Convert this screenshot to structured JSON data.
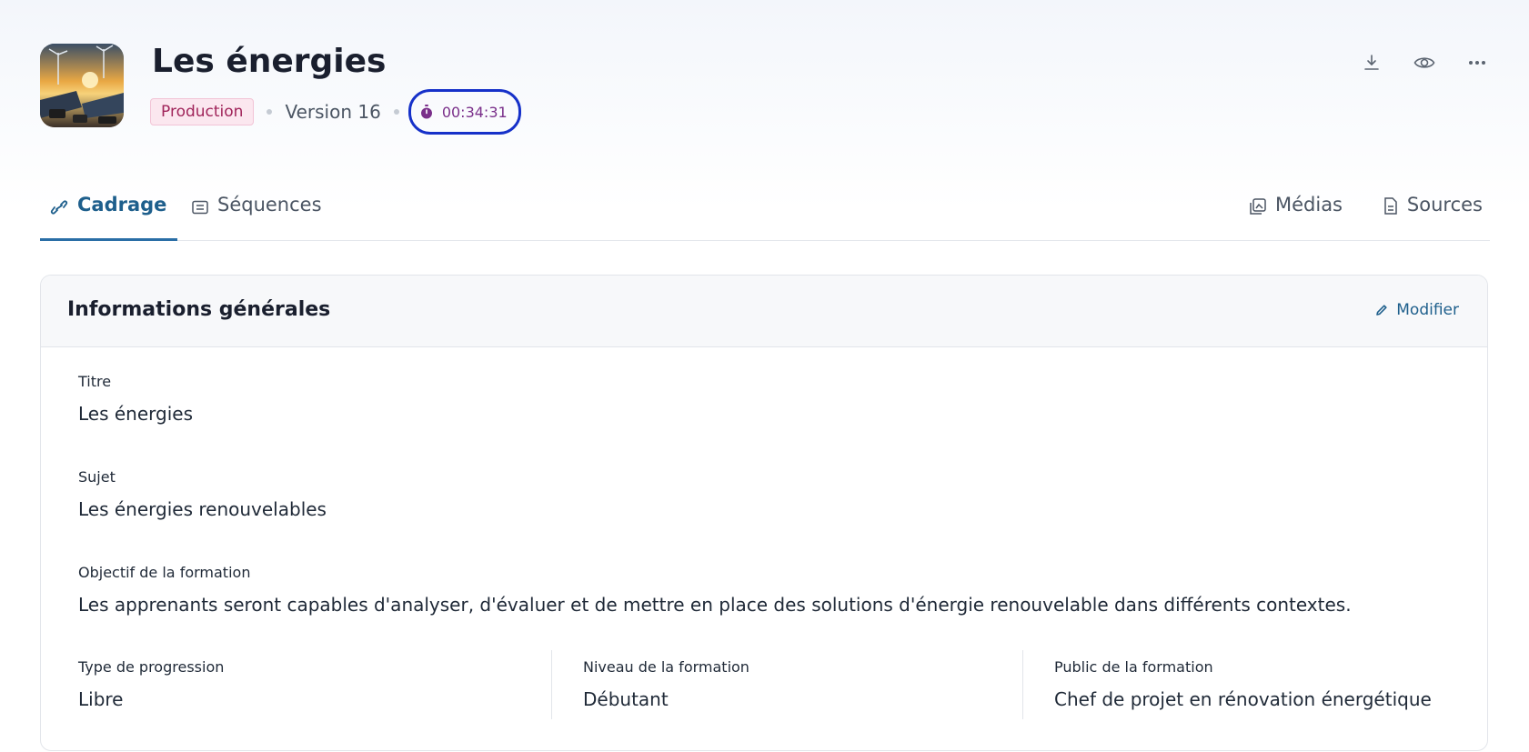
{
  "header": {
    "title": "Les énergies",
    "status_badge": "Production",
    "version": "Version 16",
    "timer": "00:34:31",
    "actions": [
      {
        "name": "download-icon"
      },
      {
        "name": "eye-icon"
      },
      {
        "name": "more-icon"
      }
    ]
  },
  "tabs": [
    {
      "label": "Cadrage",
      "icon": "link-icon",
      "active": true
    },
    {
      "label": "Séquences",
      "icon": "list-icon",
      "active": false
    },
    {
      "label": "Médias",
      "icon": "media-icon",
      "active": false
    },
    {
      "label": "Sources",
      "icon": "document-icon",
      "active": false
    }
  ],
  "card": {
    "title": "Informations générales",
    "edit_label": "Modifier",
    "fields": {
      "titre": {
        "label": "Titre",
        "value": "Les énergies"
      },
      "sujet": {
        "label": "Sujet",
        "value": "Les énergies renouvelables"
      },
      "objectif": {
        "label": "Objectif de la formation",
        "value": "Les apprenants seront capables d'analyser, d'évaluer et de mettre en place des solutions d'énergie renouvelable dans différents contextes."
      },
      "progression": {
        "label": "Type de progression",
        "value": "Libre"
      },
      "niveau": {
        "label": "Niveau de la formation",
        "value": "Débutant"
      },
      "public": {
        "label": "Public de la formation",
        "value": "Chef de projet en rénovation énergétique"
      }
    }
  },
  "colors": {
    "accent": "#1e5f8c",
    "badge_text": "#a0245a",
    "badge_bg": "#fbe7ef",
    "timer_text": "#7a2f8a",
    "highlight_ring": "#1631c9"
  }
}
